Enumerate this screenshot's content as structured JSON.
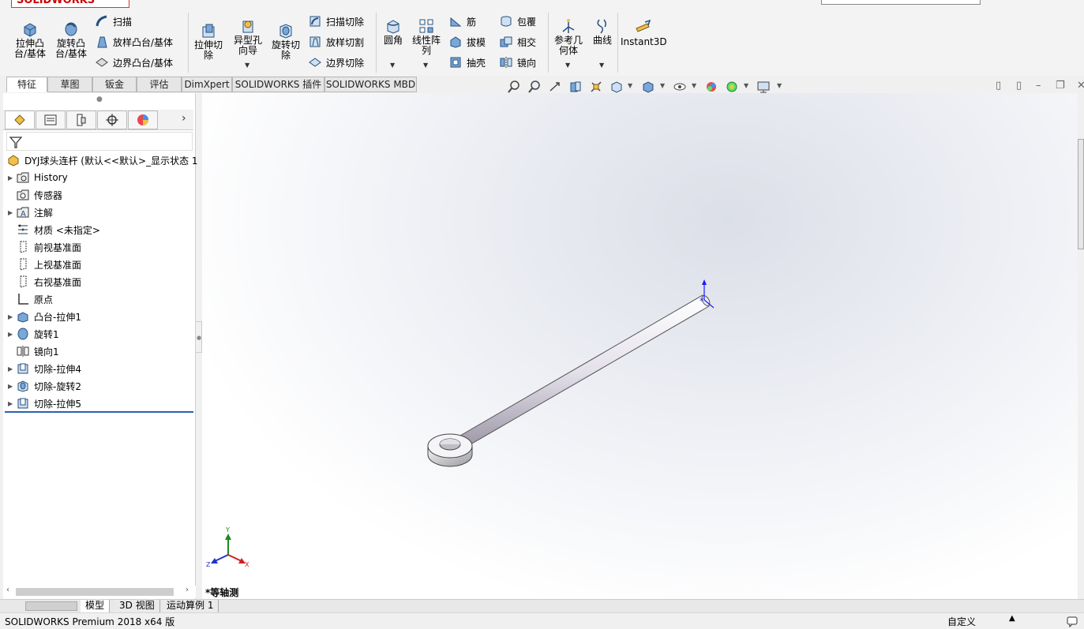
{
  "app": {
    "logo_text": "SOLIDWORKS",
    "status_text": "SOLIDWORKS Premium 2018 x64 版",
    "status_custom": "自定义",
    "view_label": "*等轴测"
  },
  "ribbon": {
    "big": [
      {
        "label1": "拉伸凸",
        "label2": "台/基体"
      },
      {
        "label1": "旋转凸",
        "label2": "台/基体"
      },
      {
        "label1": "拉伸切",
        "label2": "除"
      },
      {
        "label1": "异型孔",
        "label2": "向导"
      },
      {
        "label1": "旋转切",
        "label2": "除"
      },
      {
        "label1": "圆角",
        "label2": ""
      },
      {
        "label1": "线性阵",
        "label2": "列"
      },
      {
        "label1": "参考几",
        "label2": "何体"
      },
      {
        "label1": "曲线",
        "label2": ""
      },
      {
        "label1": "Instant3D",
        "label2": ""
      }
    ],
    "small": {
      "sweep": "扫描",
      "loft_boss": "放样凸台/基体",
      "boundary_boss": "边界凸台/基体",
      "swept_cut": "扫描切除",
      "lofted_cut": "放样切割",
      "boundary_cut": "边界切除",
      "rib": "筋",
      "draft": "拔模",
      "shell": "抽壳",
      "wrap": "包覆",
      "intersect": "相交",
      "mirror": "镜向"
    }
  },
  "tabs": [
    "特征",
    "草图",
    "钣金",
    "评估",
    "DimXpert",
    "SOLIDWORKS 插件",
    "SOLIDWORKS MBD"
  ],
  "tree": {
    "root": "DYJ球头连杆 (默认<<默认>_显示状态 1",
    "items": [
      {
        "label": "History"
      },
      {
        "label": "传感器"
      },
      {
        "label": "注解"
      },
      {
        "label": "材质 <未指定>"
      },
      {
        "label": "前视基准面"
      },
      {
        "label": "上视基准面"
      },
      {
        "label": "右视基准面"
      },
      {
        "label": "原点"
      },
      {
        "label": "凸台-拉伸1"
      },
      {
        "label": "旋转1"
      },
      {
        "label": "镜向1"
      },
      {
        "label": "切除-拉伸4"
      },
      {
        "label": "切除-旋转2"
      },
      {
        "label": "切除-拉伸5"
      }
    ]
  },
  "triad": {
    "x": "X",
    "y": "Y",
    "z": "Z"
  },
  "bottom_tabs": [
    "模型",
    "3D 视图",
    "运动算例 1"
  ],
  "colors": {
    "accent": "#2b5fb0",
    "logo_red": "#c00000",
    "tree_end": "#2b5fb0"
  }
}
